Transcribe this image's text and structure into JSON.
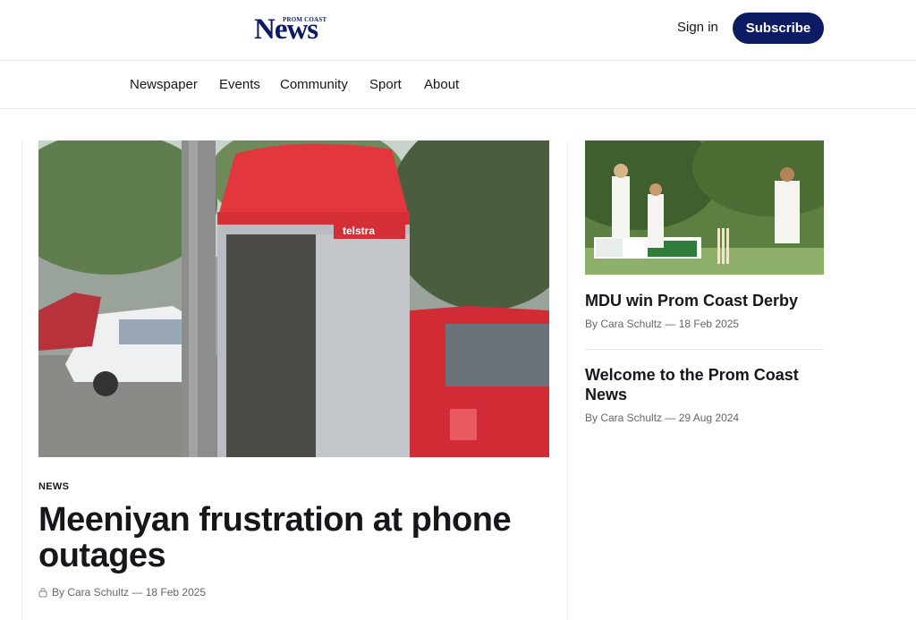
{
  "header": {
    "logo_small": "PROM COAST",
    "logo_big": "News",
    "signin_label": "Sign in",
    "subscribe_label": "Subscribe"
  },
  "nav": {
    "items": [
      "Newspaper",
      "Events",
      "Community",
      "Sport",
      "About"
    ]
  },
  "feature": {
    "tag": "NEWS",
    "title": "Meeniyan frustration at phone outages",
    "byline": "By Cara Schultz — 18 Feb 2025",
    "image_text": "telstra"
  },
  "sidebar": {
    "articles": [
      {
        "title": "MDU win Prom Coast Derby",
        "byline": "By Cara Schultz — 18 Feb 2025"
      },
      {
        "title": "Welcome to the Prom Coast News",
        "byline": "By Cara Schultz — 29 Aug 2024"
      }
    ]
  },
  "colors": {
    "brand": "#0d1b63",
    "text": "#15171a",
    "muted": "#666666"
  }
}
